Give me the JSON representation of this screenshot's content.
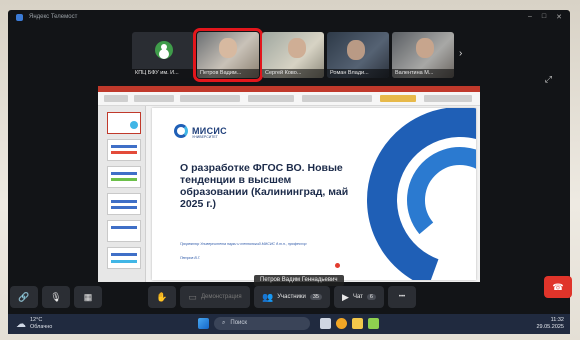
{
  "window": {
    "title": "Яндекс Телемост"
  },
  "participants": [
    {
      "name": "КПЦ БФУ им. И...",
      "has_video": false
    },
    {
      "name": "Петров Вадим...",
      "has_video": true,
      "active": true
    },
    {
      "name": "Сергей Ково...",
      "has_video": true
    },
    {
      "name": "Роман Влади...",
      "has_video": true
    },
    {
      "name": "Валентина М...",
      "has_video": true
    }
  ],
  "slide": {
    "logo": "МИСИС",
    "logo_sub": "УНИВЕРСИТЕТ",
    "title": "О разработке ФГОС ВО. Новые тенденции в высшем образовании (Калининград, май 2025 г.)",
    "caption": "Проректор Университета науки и технологий МИСИС д.т.н., профессор",
    "author": "Петров В.Г."
  },
  "speaker_label": "Петров Вадим Геннадьевич",
  "toolbar": {
    "raise_hand_icon": "hand-icon",
    "demo_label": "Демонстрация",
    "participants_label": "Участники",
    "participants_count": "35",
    "chat_label": "Чат",
    "chat_count": "6",
    "more_label": "•••"
  },
  "taskbar": {
    "temperature": "12°C",
    "weather": "Облачно",
    "search_placeholder": "Поиск",
    "time": "11:32",
    "date": "29.05.2025"
  },
  "colors": {
    "accent": "#e3161c",
    "brand_blue": "#1f5fb6",
    "end_call": "#e0342a"
  }
}
